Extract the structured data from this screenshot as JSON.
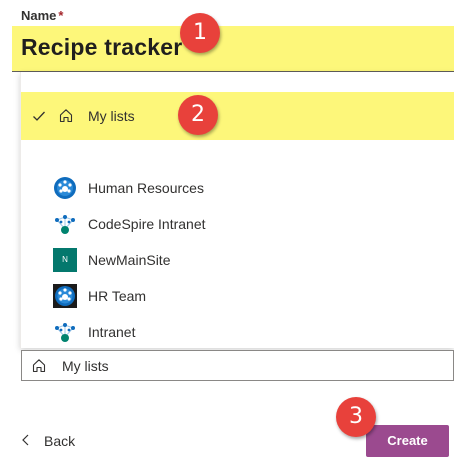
{
  "form": {
    "name_label": "Name",
    "required_mark": "*",
    "name_value": "Recipe tracker"
  },
  "dropdown": {
    "selected": {
      "label": "My lists",
      "icon": "home-icon",
      "check_icon": "checkmark-icon"
    },
    "sites": [
      {
        "label": "Human Resources",
        "icon": "site-hub-icon"
      },
      {
        "label": "CodeSpire Intranet",
        "icon": "site-network-icon"
      },
      {
        "label": "NewMainSite",
        "icon": "site-letter-icon",
        "initial": "N"
      },
      {
        "label": "HR Team",
        "icon": "site-hub-dark-icon"
      },
      {
        "label": "Intranet",
        "icon": "site-network-icon"
      }
    ]
  },
  "location_select": {
    "value": "My lists",
    "icon": "home-icon"
  },
  "footer": {
    "back_label": "Back",
    "create_label": "Create"
  },
  "callouts": [
    "1",
    "2",
    "3"
  ],
  "colors": {
    "highlight": "#fdf77a",
    "create_button": "#9b4a8f",
    "callout": "#e8413b",
    "site_blue": "#0f6cbd",
    "site_green": "#00836f",
    "newmainsite_tile": "#04786d"
  }
}
